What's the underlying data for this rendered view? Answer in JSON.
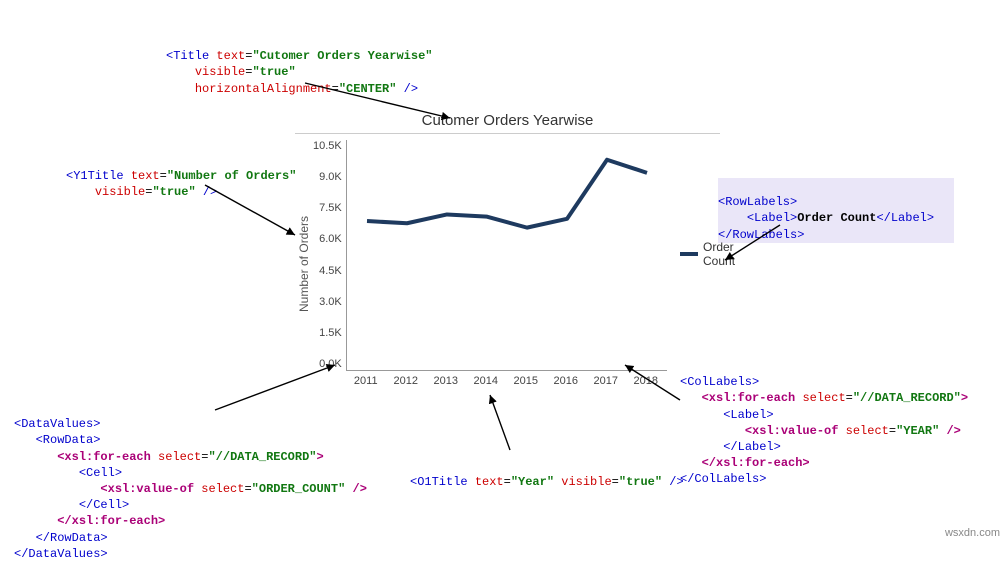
{
  "chart_data": {
    "type": "line",
    "title": "Cutomer Orders Yearwise",
    "xlabel": "",
    "ylabel": "Number of Orders",
    "categories": [
      "2011",
      "2012",
      "2013",
      "2014",
      "2015",
      "2016",
      "2017",
      "2018"
    ],
    "series": [
      {
        "name": "Order Count",
        "values": [
          6800,
          6700,
          7100,
          7000,
          6500,
          6900,
          9600,
          9000
        ]
      }
    ],
    "ylim": [
      0,
      10500
    ],
    "yticks": [
      "10.5K",
      "9.0K",
      "7.5K",
      "6.0K",
      "4.5K",
      "3.0K",
      "1.5K",
      "0.0K"
    ]
  },
  "annotations": {
    "title_code": "<Title text=\"Cutomer Orders Yearwise\"\n    visible=\"true\"\n    horizontalAlignment=\"CENTER\" />",
    "y1title_code": "<Y1Title text=\"Number of Orders\"\n    visible=\"true\" />",
    "rowlabels_code": "<RowLabels>\n    <Label>Order Count</Label>\n</RowLabels>",
    "collabels_code": "<ColLabels>\n   <xsl:for-each select=\"//DATA_RECORD\">\n      <Label>\n         <xsl:value-of select=\"YEAR\" />\n      </Label>\n   </xsl:for-each>\n</ColLabels>",
    "datavalues_code": "<DataValues>\n   <RowData>\n      <xsl:for-each select=\"//DATA_RECORD\">\n         <Cell>\n            <xsl:value-of select=\"ORDER_COUNT\" />\n         </Cell>\n      </xsl:for-each>\n   </RowData>\n</DataValues>",
    "o1title_code": "<O1Title text=\"Year\" visible=\"true\" />"
  },
  "watermark": "wsxdn.com"
}
